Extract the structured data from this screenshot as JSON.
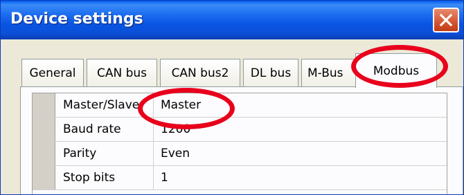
{
  "window": {
    "title": "Device settings",
    "close_icon": "close-icon"
  },
  "tabs": [
    {
      "label": "General"
    },
    {
      "label": "CAN bus"
    },
    {
      "label": "CAN bus2"
    },
    {
      "label": "DL bus"
    },
    {
      "label": "M-Bus"
    },
    {
      "label": "Modbus",
      "active": true
    }
  ],
  "settings": [
    {
      "name": "Master/Slave",
      "value": "Master"
    },
    {
      "name": "Baud rate",
      "value": "1200"
    },
    {
      "name": "Parity",
      "value": "Even"
    },
    {
      "name": "Stop bits",
      "value": "1"
    }
  ],
  "colors": {
    "highlight": "#e8001c",
    "titlebar": "#0a55e3",
    "close_button": "#d55a35"
  }
}
